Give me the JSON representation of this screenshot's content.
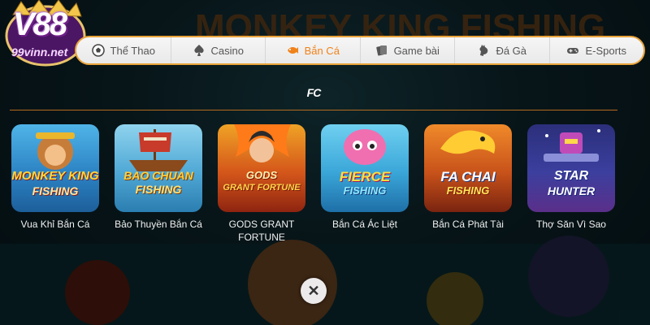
{
  "logo": {
    "main": "V88",
    "sub": "99vinn.net"
  },
  "nav": {
    "items": [
      {
        "label": "Thể Thao",
        "icon": "soccer-ball-icon",
        "active": false
      },
      {
        "label": "Casino",
        "icon": "spade-icon",
        "active": false
      },
      {
        "label": "Bắn Cá",
        "icon": "fish-icon",
        "active": true
      },
      {
        "label": "Game bài",
        "icon": "cards-icon",
        "active": false
      },
      {
        "label": "Đá Gà",
        "icon": "rooster-icon",
        "active": false
      },
      {
        "label": "E-Sports",
        "icon": "gamepad-icon",
        "active": false
      }
    ],
    "active_color": "#f0821a"
  },
  "provider": {
    "badge": "FC"
  },
  "games": [
    {
      "name": "Vua Khỉ Bắn Cá",
      "art_line1": "MONKEY KING",
      "art_line2": "FISHING"
    },
    {
      "name": "Bảo Thuyền Bắn Cá",
      "art_line1": "BAO CHUAN",
      "art_line2": "FISHING"
    },
    {
      "name": "GODS GRANT FORTUNE",
      "art_line1": "GODS",
      "art_line2": "GRANT FORTUNE"
    },
    {
      "name": "Bắn Cá Ác Liệt",
      "art_line1": "FIERCE",
      "art_line2": "FISHING"
    },
    {
      "name": "Bắn Cá Phát Tài",
      "art_line1": "FA CHAI",
      "art_line2": "FISHING"
    },
    {
      "name": "Thợ Săn Vì Sao",
      "art_line1": "STAR",
      "art_line2": "HUNTER"
    }
  ],
  "background_title": "MONKEY KING FISHING",
  "close": {
    "icon": "close-icon",
    "glyph": "✕"
  }
}
